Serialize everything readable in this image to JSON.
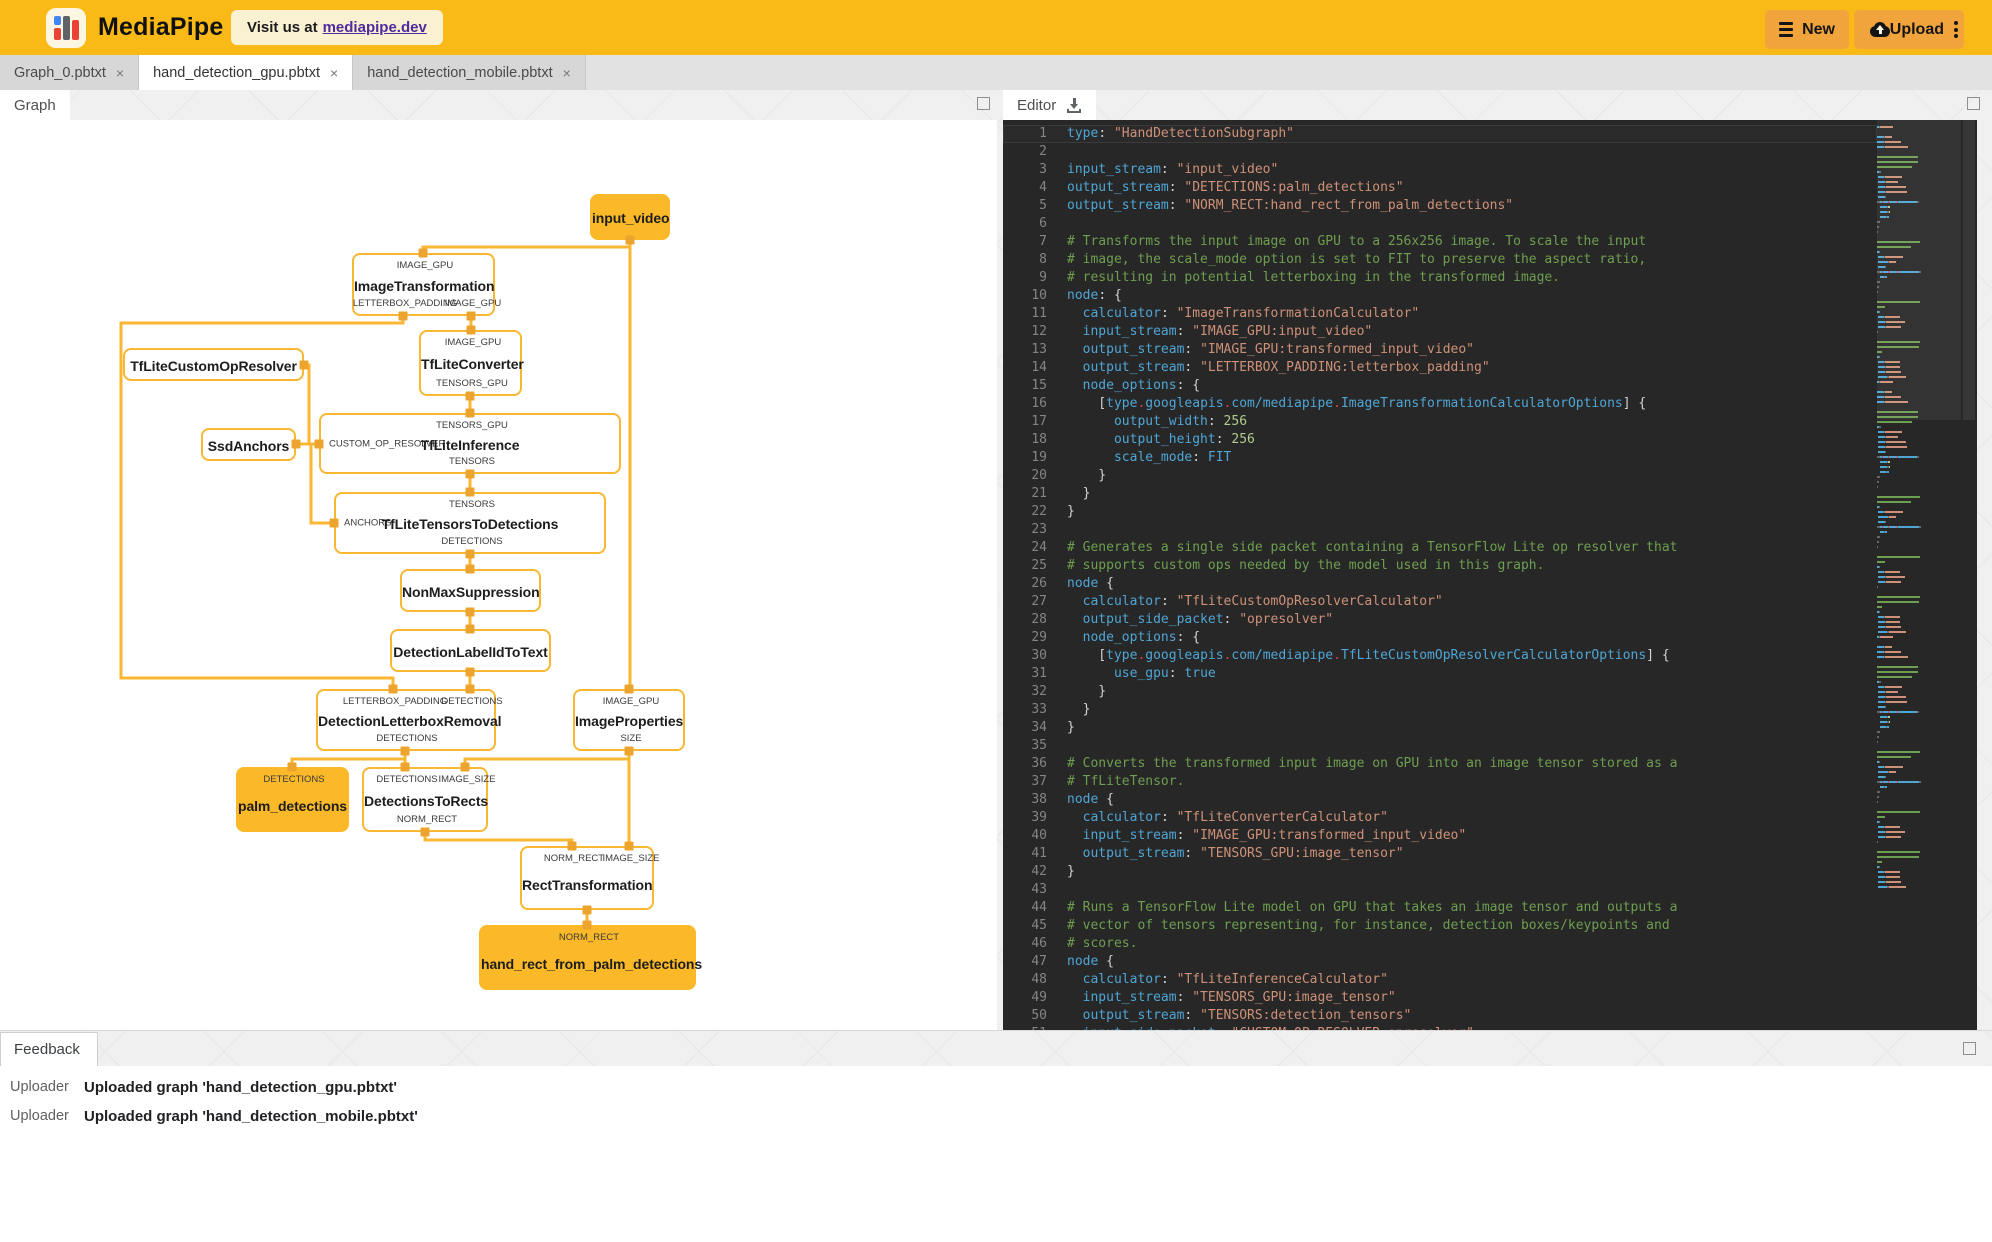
{
  "header": {
    "app_title": "MediaPipe",
    "visit_text": "Visit us at",
    "visit_link": "mediapipe.dev",
    "new_button": "New",
    "upload_button": "Upload",
    "colors": {
      "header_bg": "#F9B916",
      "button_bg": "#F1A33C",
      "link": "#4F2B9E",
      "accent": "#F9B733"
    }
  },
  "file_tabs": [
    {
      "label": "Graph_0.pbtxt",
      "active": false
    },
    {
      "label": "hand_detection_gpu.pbtxt",
      "active": true
    },
    {
      "label": "hand_detection_mobile.pbtxt",
      "active": false
    }
  ],
  "graph_panel": {
    "tab_label": "Graph",
    "nodes": {
      "input_video": {
        "title": "input_video",
        "kind": "packet"
      },
      "ImageTransformation": {
        "title": "ImageTransformation",
        "kind": "calc",
        "top": [
          "IMAGE_GPU"
        ],
        "bottom": [
          "LETTERBOX_PADDING",
          "IMAGE_GPU"
        ]
      },
      "TfLiteConverter": {
        "title": "TfLiteConverter",
        "kind": "calc",
        "top": [
          "IMAGE_GPU"
        ],
        "bottom": [
          "TENSORS_GPU"
        ]
      },
      "TfLiteCustomOpResolver": {
        "title": "TfLiteCustomOpResolver",
        "kind": "calc"
      },
      "SsdAnchors": {
        "title": "SsdAnchors",
        "kind": "calc"
      },
      "TfLiteInference": {
        "title": "TfLiteInference",
        "kind": "calc",
        "top": [
          "TENSORS_GPU"
        ],
        "left": "CUSTOM_OP_RESOLVER",
        "bottom": [
          "TENSORS"
        ]
      },
      "TfLiteTensorsToDetections": {
        "title": "TfLiteTensorsToDetections",
        "kind": "calc",
        "top": [
          "TENSORS"
        ],
        "left": "ANCHORS",
        "bottom": [
          "DETECTIONS"
        ]
      },
      "NonMaxSuppression": {
        "title": "NonMaxSuppression",
        "kind": "calc"
      },
      "DetectionLabelIdToText": {
        "title": "DetectionLabelIdToText",
        "kind": "calc"
      },
      "DetectionLetterboxRemoval": {
        "title": "DetectionLetterboxRemoval",
        "kind": "calc",
        "top": [
          "LETTERBOX_PADDING",
          "DETECTIONS"
        ],
        "bottom": [
          "DETECTIONS"
        ]
      },
      "ImageProperties": {
        "title": "ImageProperties",
        "kind": "calc",
        "top": [
          "IMAGE_GPU"
        ],
        "bottom": [
          "SIZE"
        ]
      },
      "palm_detections": {
        "title": "palm_detections",
        "kind": "packet",
        "top": [
          "DETECTIONS"
        ]
      },
      "DetectionsToRects": {
        "title": "DetectionsToRects",
        "kind": "calc",
        "top": [
          "DETECTIONS",
          "IMAGE_SIZE"
        ],
        "bottom": [
          "NORM_RECT"
        ]
      },
      "RectTransformation": {
        "title": "RectTransformation",
        "kind": "calc",
        "top": [
          "NORM_RECT",
          "IMAGE_SIZE"
        ]
      },
      "hand_rect_from_palm_detections": {
        "title": "hand_rect_from_palm_detections",
        "kind": "packet",
        "top": [
          "NORM_RECT"
        ]
      }
    },
    "connections": [
      {
        "from": "input_video",
        "to": "ImageTransformation:IMAGE_GPU"
      },
      {
        "from": "input_video",
        "to": "ImageProperties:IMAGE_GPU"
      },
      {
        "from": "ImageTransformation:IMAGE_GPU",
        "to": "TfLiteConverter:IMAGE_GPU"
      },
      {
        "from": "ImageTransformation:LETTERBOX_PADDING",
        "to": "DetectionLetterboxRemoval:LETTERBOX_PADDING"
      },
      {
        "from": "TfLiteCustomOpResolver",
        "to": "TfLiteInference:CUSTOM_OP_RESOLVER"
      },
      {
        "from": "TfLiteConverter:TENSORS_GPU",
        "to": "TfLiteInference:TENSORS_GPU"
      },
      {
        "from": "SsdAnchors",
        "to": "TfLiteTensorsToDetections:ANCHORS"
      },
      {
        "from": "TfLiteInference:TENSORS",
        "to": "TfLiteTensorsToDetections:TENSORS"
      },
      {
        "from": "TfLiteTensorsToDetections:DETECTIONS",
        "to": "NonMaxSuppression"
      },
      {
        "from": "NonMaxSuppression",
        "to": "DetectionLabelIdToText"
      },
      {
        "from": "DetectionLabelIdToText",
        "to": "DetectionLetterboxRemoval:DETECTIONS"
      },
      {
        "from": "DetectionLetterboxRemoval:DETECTIONS",
        "to": "palm_detections"
      },
      {
        "from": "DetectionLetterboxRemoval:DETECTIONS",
        "to": "DetectionsToRects:DETECTIONS"
      },
      {
        "from": "ImageProperties:SIZE",
        "to": "DetectionsToRects:IMAGE_SIZE"
      },
      {
        "from": "ImageProperties:SIZE",
        "to": "RectTransformation:IMAGE_SIZE"
      },
      {
        "from": "DetectionsToRects:NORM_RECT",
        "to": "RectTransformation:NORM_RECT"
      },
      {
        "from": "RectTransformation:NORM_RECT",
        "to": "hand_rect_from_palm_detections"
      }
    ]
  },
  "editor": {
    "tab_label": "Editor",
    "code_lines": [
      [
        [
          "k",
          "type"
        ],
        [
          "p",
          ": "
        ],
        [
          "s",
          "\"HandDetectionSubgraph\""
        ]
      ],
      [],
      [
        [
          "k",
          "input_stream"
        ],
        [
          "p",
          ": "
        ],
        [
          "s",
          "\"input_video\""
        ]
      ],
      [
        [
          "k",
          "output_stream"
        ],
        [
          "p",
          ": "
        ],
        [
          "s",
          "\"DETECTIONS:palm_detections\""
        ]
      ],
      [
        [
          "k",
          "output_stream"
        ],
        [
          "p",
          ": "
        ],
        [
          "s",
          "\"NORM_RECT:hand_rect_from_palm_detections\""
        ]
      ],
      [],
      [
        [
          "c",
          "# Transforms the input image on GPU to a 256x256 image. To scale the input"
        ]
      ],
      [
        [
          "c",
          "# image, the scale_mode option is set to FIT to preserve the aspect ratio,"
        ]
      ],
      [
        [
          "c",
          "# resulting in potential letterboxing in the transformed image."
        ]
      ],
      [
        [
          "k",
          "node"
        ],
        [
          "p",
          ": {"
        ]
      ],
      [
        [
          "p",
          "  "
        ],
        [
          "k",
          "calculator"
        ],
        [
          "p",
          ": "
        ],
        [
          "s",
          "\"ImageTransformationCalculator\""
        ]
      ],
      [
        [
          "p",
          "  "
        ],
        [
          "k",
          "input_stream"
        ],
        [
          "p",
          ": "
        ],
        [
          "s",
          "\"IMAGE_GPU:input_video\""
        ]
      ],
      [
        [
          "p",
          "  "
        ],
        [
          "k",
          "output_stream"
        ],
        [
          "p",
          ": "
        ],
        [
          "s",
          "\"IMAGE_GPU:transformed_input_video\""
        ]
      ],
      [
        [
          "p",
          "  "
        ],
        [
          "k",
          "output_stream"
        ],
        [
          "p",
          ": "
        ],
        [
          "s",
          "\"LETTERBOX_PADDING:letterbox_padding\""
        ]
      ],
      [
        [
          "p",
          "  "
        ],
        [
          "k",
          "node_options"
        ],
        [
          "p",
          ": {"
        ]
      ],
      [
        [
          "p",
          "    ["
        ],
        [
          "u",
          "type"
        ],
        [
          "d",
          "."
        ],
        [
          "u",
          "googleapis"
        ],
        [
          "d",
          "."
        ],
        [
          "u",
          "com/mediapipe"
        ],
        [
          "d",
          "."
        ],
        [
          "u",
          "ImageTransformationCalculatorOptions"
        ],
        [
          "p",
          "] {"
        ]
      ],
      [
        [
          "p",
          "      "
        ],
        [
          "k",
          "output_width"
        ],
        [
          "p",
          ": "
        ],
        [
          "n",
          "256"
        ]
      ],
      [
        [
          "p",
          "      "
        ],
        [
          "k",
          "output_height"
        ],
        [
          "p",
          ": "
        ],
        [
          "n",
          "256"
        ]
      ],
      [
        [
          "p",
          "      "
        ],
        [
          "k",
          "scale_mode"
        ],
        [
          "p",
          ": "
        ],
        [
          "u",
          "FIT"
        ]
      ],
      [
        [
          "p",
          "    }"
        ]
      ],
      [
        [
          "p",
          "  }"
        ]
      ],
      [
        [
          "p",
          "}"
        ]
      ],
      [],
      [
        [
          "c",
          "# Generates a single side packet containing a TensorFlow Lite op resolver that"
        ]
      ],
      [
        [
          "c",
          "# supports custom ops needed by the model used in this graph."
        ]
      ],
      [
        [
          "k",
          "node"
        ],
        [
          "p",
          " {"
        ]
      ],
      [
        [
          "p",
          "  "
        ],
        [
          "k",
          "calculator"
        ],
        [
          "p",
          ": "
        ],
        [
          "s",
          "\"TfLiteCustomOpResolverCalculator\""
        ]
      ],
      [
        [
          "p",
          "  "
        ],
        [
          "k",
          "output_side_packet"
        ],
        [
          "p",
          ": "
        ],
        [
          "s",
          "\"opresolver\""
        ]
      ],
      [
        [
          "p",
          "  "
        ],
        [
          "k",
          "node_options"
        ],
        [
          "p",
          ": {"
        ]
      ],
      [
        [
          "p",
          "    ["
        ],
        [
          "u",
          "type"
        ],
        [
          "d",
          "."
        ],
        [
          "u",
          "googleapis"
        ],
        [
          "d",
          "."
        ],
        [
          "u",
          "com/mediapipe"
        ],
        [
          "d",
          "."
        ],
        [
          "u",
          "TfLiteCustomOpResolverCalculatorOptions"
        ],
        [
          "p",
          "] {"
        ]
      ],
      [
        [
          "p",
          "      "
        ],
        [
          "k",
          "use_gpu"
        ],
        [
          "p",
          ": "
        ],
        [
          "u",
          "true"
        ]
      ],
      [
        [
          "p",
          "    }"
        ]
      ],
      [
        [
          "p",
          "  }"
        ]
      ],
      [
        [
          "p",
          "}"
        ]
      ],
      [],
      [
        [
          "c",
          "# Converts the transformed input image on GPU into an image tensor stored as a"
        ]
      ],
      [
        [
          "c",
          "# TfLiteTensor."
        ]
      ],
      [
        [
          "k",
          "node"
        ],
        [
          "p",
          " {"
        ]
      ],
      [
        [
          "p",
          "  "
        ],
        [
          "k",
          "calculator"
        ],
        [
          "p",
          ": "
        ],
        [
          "s",
          "\"TfLiteConverterCalculator\""
        ]
      ],
      [
        [
          "p",
          "  "
        ],
        [
          "k",
          "input_stream"
        ],
        [
          "p",
          ": "
        ],
        [
          "s",
          "\"IMAGE_GPU:transformed_input_video\""
        ]
      ],
      [
        [
          "p",
          "  "
        ],
        [
          "k",
          "output_stream"
        ],
        [
          "p",
          ": "
        ],
        [
          "s",
          "\"TENSORS_GPU:image_tensor\""
        ]
      ],
      [
        [
          "p",
          "}"
        ]
      ],
      [],
      [
        [
          "c",
          "# Runs a TensorFlow Lite model on GPU that takes an image tensor and outputs a"
        ]
      ],
      [
        [
          "c",
          "# vector of tensors representing, for instance, detection boxes/keypoints and"
        ]
      ],
      [
        [
          "c",
          "# scores."
        ]
      ],
      [
        [
          "k",
          "node"
        ],
        [
          "p",
          " {"
        ]
      ],
      [
        [
          "p",
          "  "
        ],
        [
          "k",
          "calculator"
        ],
        [
          "p",
          ": "
        ],
        [
          "s",
          "\"TfLiteInferenceCalculator\""
        ]
      ],
      [
        [
          "p",
          "  "
        ],
        [
          "k",
          "input_stream"
        ],
        [
          "p",
          ": "
        ],
        [
          "s",
          "\"TENSORS_GPU:image_tensor\""
        ]
      ],
      [
        [
          "p",
          "  "
        ],
        [
          "k",
          "output_stream"
        ],
        [
          "p",
          ": "
        ],
        [
          "s",
          "\"TENSORS:detection_tensors\""
        ]
      ],
      [
        [
          "p",
          "  "
        ],
        [
          "k",
          "input_side_packet"
        ],
        [
          "p",
          ": "
        ],
        [
          "s",
          "\"CUSTOM_OP_RESOLVER:opresolver\""
        ]
      ]
    ]
  },
  "feedback": {
    "tab_label": "Feedback",
    "rows": [
      {
        "source": "Uploader",
        "message": "Uploaded graph 'hand_detection_gpu.pbtxt'"
      },
      {
        "source": "Uploader",
        "message": "Uploaded graph 'hand_detection_mobile.pbtxt'"
      }
    ]
  }
}
